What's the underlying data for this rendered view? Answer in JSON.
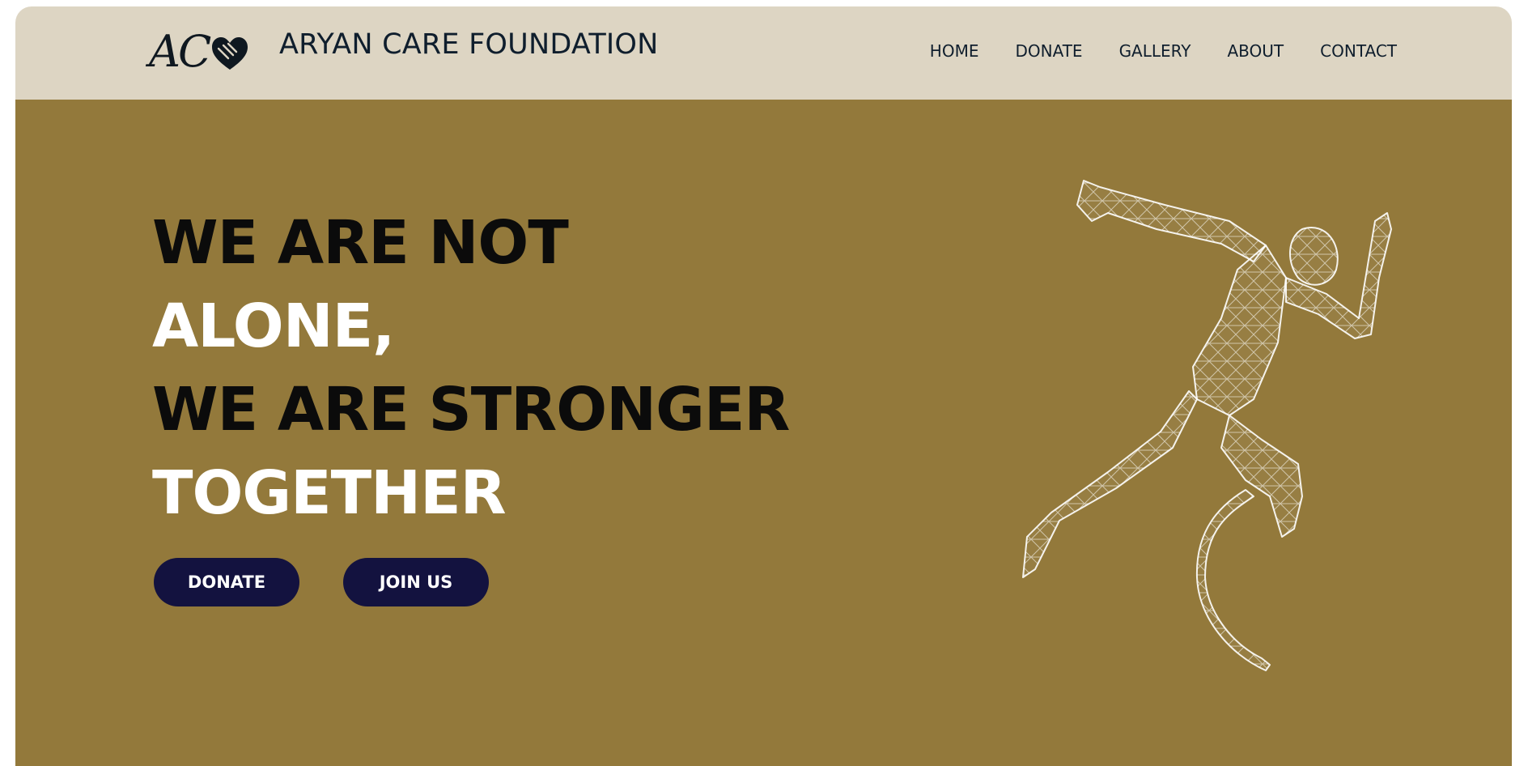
{
  "header": {
    "logo_mark": "AC",
    "brand_name": "ARYAN CARE FOUNDATION",
    "nav": [
      {
        "label": "HOME"
      },
      {
        "label": "DONATE"
      },
      {
        "label": "GALLERY"
      },
      {
        "label": "ABOUT"
      },
      {
        "label": "CONTACT"
      }
    ]
  },
  "hero": {
    "headline_lines": [
      "WE ARE NOT",
      "ALONE,",
      "WE ARE STRONGER",
      "TOGETHER"
    ],
    "buttons": {
      "donate": "DONATE",
      "join": "JOIN US"
    },
    "image": "wireframe-runner-with-prosthetic-leg-icon"
  },
  "colors": {
    "navbar_bg": "#ddd5c3",
    "hero_bg": "#93793b",
    "button_bg": "#13123f",
    "text_dark": "#0f1e2d",
    "headline_dark": "#0b0b0b",
    "headline_light": "#ffffff"
  }
}
